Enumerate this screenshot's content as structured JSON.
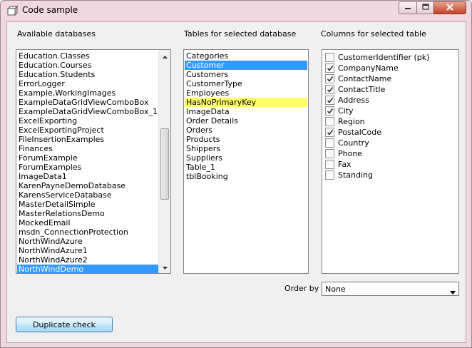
{
  "window": {
    "title": "Code sample"
  },
  "databases": {
    "label": "Available databases",
    "items": [
      "Education.Classes",
      "Education.Courses",
      "Education.Students",
      "ErrorLogger",
      "Example,WorkingImages",
      "ExampleDataGridViewComboBox",
      "ExampleDataGridViewComboBox_1",
      "ExcelExporting",
      "ExcelExportingProject",
      "FileInsertionExamples",
      "Finances",
      "ForumExample",
      "ForumExamples",
      "ImageData1",
      "KarenPayneDemoDatabase",
      "KarensServiceDatabase",
      "MasterDetailSimple",
      "MasterRelationsDemo",
      "MockedEmail",
      "msdn_ConnectionProtection",
      "NorthWindAzure",
      "NorthWindAzure1",
      "NorthWindAzure2",
      "NorthWindDemo"
    ],
    "selected": "NorthWindDemo"
  },
  "tables": {
    "label": "Tables for selected database",
    "items": [
      "Categories",
      "Customer",
      "Customers",
      "CustomerType",
      "Employees",
      "HasNoPrimaryKey",
      "ImageData",
      "Order Details",
      "Orders",
      "Products",
      "Shippers",
      "Suppliers",
      "Table_1",
      "tblBooking"
    ],
    "selected": "Customer",
    "highlighted": "HasNoPrimaryKey"
  },
  "columns": {
    "label": "Columns for selected table",
    "items": [
      {
        "name": "CustomerIdentifier (pk)",
        "checked": false
      },
      {
        "name": "CompanyName",
        "checked": true
      },
      {
        "name": "ContactName",
        "checked": true
      },
      {
        "name": "ContactTitle",
        "checked": true
      },
      {
        "name": "Address",
        "checked": true
      },
      {
        "name": "City",
        "checked": true
      },
      {
        "name": "Region",
        "checked": false
      },
      {
        "name": "PostalCode",
        "checked": true
      },
      {
        "name": "Country",
        "checked": false
      },
      {
        "name": "Phone",
        "checked": false
      },
      {
        "name": "Fax",
        "checked": false
      },
      {
        "name": "Standing",
        "checked": false
      }
    ]
  },
  "order_by": {
    "label": "Order by",
    "value": "None"
  },
  "actions": {
    "duplicate_check": "Duplicate check"
  },
  "icons": {
    "app": "app-window-icon",
    "minimize": "minimize-icon",
    "maximize": "maximize-icon",
    "close": "close-icon"
  }
}
